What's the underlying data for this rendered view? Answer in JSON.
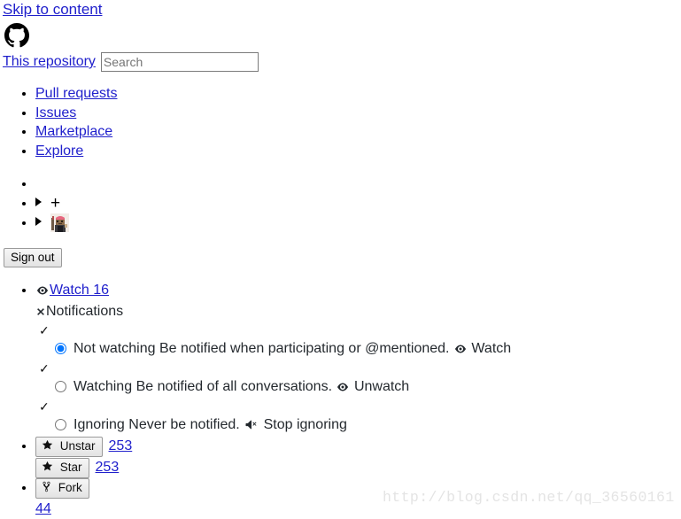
{
  "skip": {
    "label": "Skip to content"
  },
  "brand": {
    "icon": "github-mark-icon"
  },
  "search": {
    "scope_label": "This repository",
    "placeholder": "Search",
    "value": ""
  },
  "primary_nav": {
    "items": [
      {
        "label": "Pull requests"
      },
      {
        "label": "Issues"
      },
      {
        "label": "Marketplace"
      },
      {
        "label": "Explore"
      }
    ]
  },
  "user_nav": {
    "items": [
      {
        "label": "",
        "icon": "",
        "caret": false
      },
      {
        "label": "+",
        "icon": "plus-icon",
        "caret": true
      },
      {
        "label": "",
        "icon": "user-avatar",
        "caret": true
      }
    ],
    "signout_label": "Sign out"
  },
  "repo_actions": {
    "watch": {
      "icon": "eye-icon",
      "label": "Watch",
      "count": "16",
      "link_text": "Watch 16"
    },
    "notifications": {
      "icon": "x-icon",
      "label": "Notifications"
    },
    "options": [
      {
        "check": "✓",
        "selected": true,
        "title": "Not watching",
        "description": "Be notified when participating or @mentioned.",
        "action_icon": "eye-icon",
        "action_label": "Watch"
      },
      {
        "check": "✓",
        "selected": false,
        "title": "Watching",
        "description": "Be notified of all conversations.",
        "action_icon": "eye-icon",
        "action_label": "Unwatch"
      },
      {
        "check": "✓",
        "selected": false,
        "title": "Ignoring",
        "description": "Never be notified.",
        "action_icon": "mute-icon",
        "action_label": "Stop ignoring"
      }
    ],
    "unstar": {
      "icon": "star-icon",
      "label": "Unstar",
      "count": "253"
    },
    "star": {
      "icon": "star-icon",
      "label": "Star",
      "count": "253"
    },
    "fork": {
      "icon": "fork-icon",
      "label": "Fork",
      "count": "44"
    }
  },
  "watermark": {
    "text": "http://blog.csdn.net/qq_36560161"
  },
  "colors": {
    "link": "#2020cc",
    "text": "#24292e",
    "button_border": "#9a9a9a",
    "watermark": "#e4e4e4"
  }
}
